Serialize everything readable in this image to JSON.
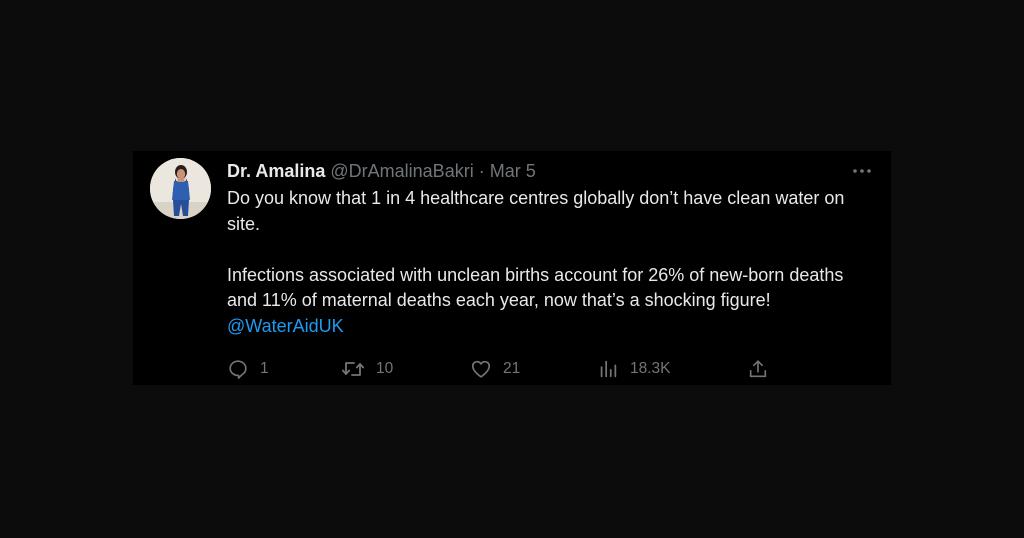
{
  "tweet": {
    "display_name": "Dr. Amalina",
    "handle": "@DrAmalinaBakri",
    "separator": "·",
    "date": "Mar 5",
    "paragraph1": "Do you know that 1 in 4 healthcare centres globally don’t have clean water on site.",
    "paragraph2": "Infections associated with unclean births account for 26% of new-born deaths and 11% of maternal deaths each year, now that’s a shocking figure!",
    "mention": "@WaterAidUK"
  },
  "actions": {
    "replies": "1",
    "retweets": "10",
    "likes": "21",
    "views": "18.3K"
  },
  "icons": {
    "more": "more-horizontal-icon",
    "reply": "reply-bubble-icon",
    "retweet": "retweet-icon",
    "like": "heart-icon",
    "views": "bar-chart-icon",
    "share": "share-upload-icon"
  },
  "colors": {
    "background": "#0c0c0c",
    "card": "#000000",
    "text": "#e7e9ea",
    "secondary": "#71767b",
    "link": "#1d9bf0"
  }
}
